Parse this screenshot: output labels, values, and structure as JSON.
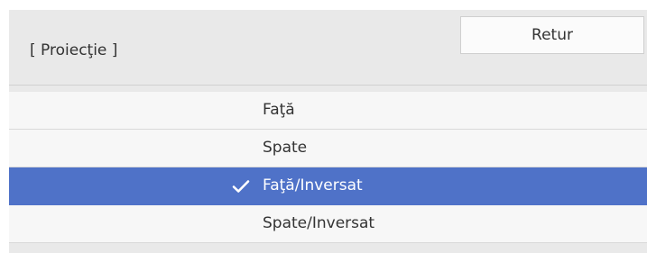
{
  "header": {
    "title": "[ Proiecţie ]",
    "back_label": "Retur"
  },
  "options": [
    {
      "label": "Faţă",
      "selected": false
    },
    {
      "label": "Spate",
      "selected": false
    },
    {
      "label": "Faţă/Inversat",
      "selected": true,
      "icon": "check-icon"
    },
    {
      "label": "Spate/Inversat",
      "selected": false
    }
  ],
  "colors": {
    "selected_background": "#4f72c8",
    "panel_background": "#e9e9e9",
    "row_background": "#f7f7f7"
  }
}
